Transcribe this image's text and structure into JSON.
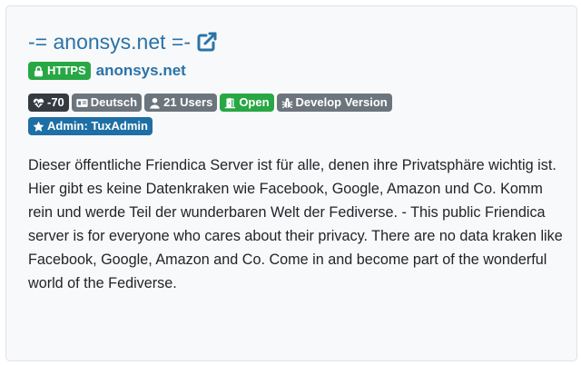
{
  "server": {
    "title": "-= anonsys.net =-",
    "https_label": "HTTPS",
    "url_text": "anonsys.net"
  },
  "badges": {
    "health": "-70",
    "language": "Deutsch",
    "users": "21 Users",
    "registration": "Open",
    "version": "Develop Version",
    "admin": "Admin: TuxAdmin"
  },
  "description": "Dieser öffentliche Friendica Server ist für alle, denen ihre Privatsphäre wichtig ist. Hier gibt es keine Datenkraken wie Facebook, Google, Amazon und Co. Komm rein und werde Teil der wunderbaren Welt der Fediverse. - This public Friendica server is for everyone who cares about their privacy. There are no data kraken like Facebook, Google, Amazon and Co. Come in and become part of the wonderful world of the Fediverse.",
  "icons": {
    "title": "external-link-icon",
    "https": "lock-icon",
    "health": "heartbeat-icon",
    "language": "language-icon",
    "users": "user-icon",
    "registration": "door-open-icon",
    "version": "bug-icon",
    "admin": "star-icon"
  },
  "colors": {
    "link": "#2a73a8",
    "green": "#28a745",
    "dark": "#343a40",
    "gray": "#6c757d",
    "blue": "#1d6fa5"
  }
}
